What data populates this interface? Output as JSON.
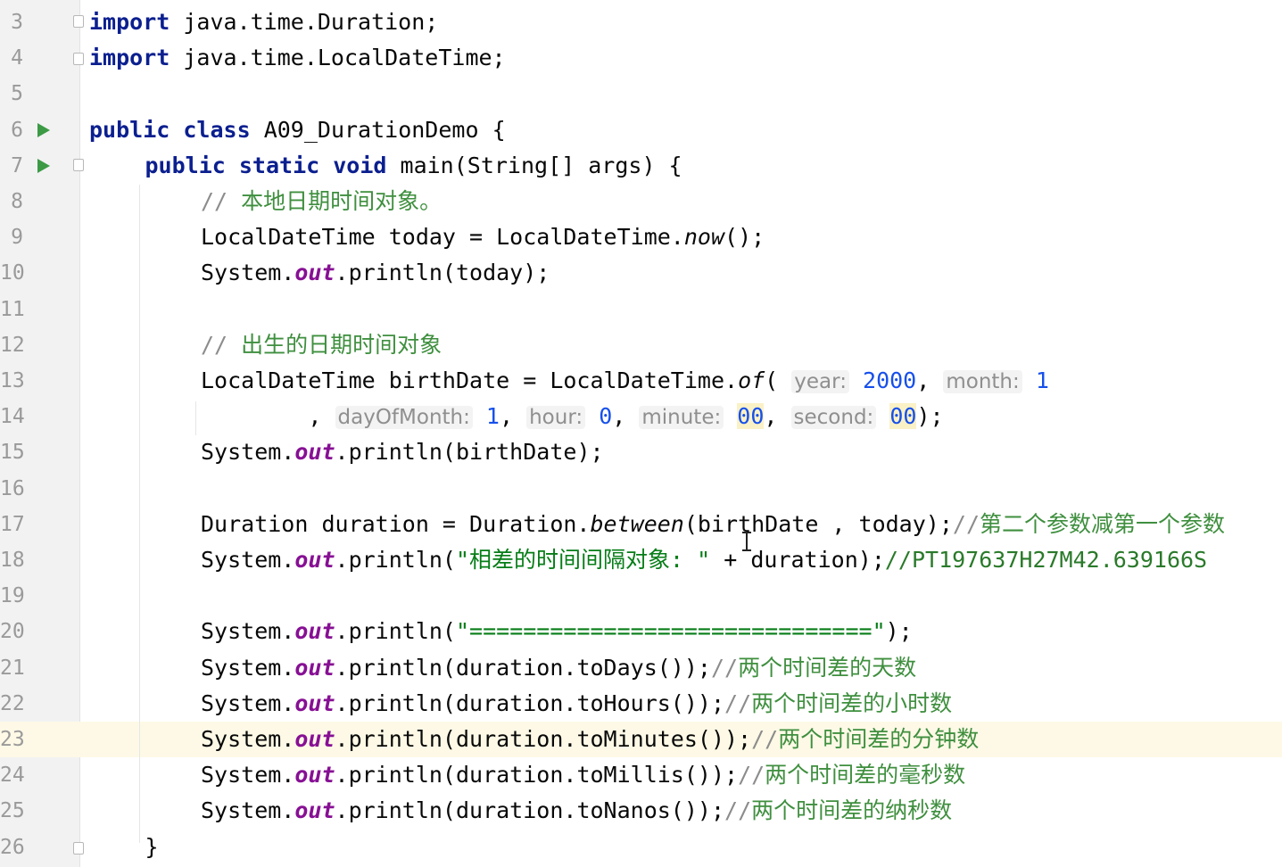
{
  "editor": {
    "lines": [
      {
        "n": "3",
        "indent": 0,
        "fold": "start",
        "parts": [
          {
            "t": "import",
            "c": "kw"
          },
          {
            "t": " java.time.Duration;"
          }
        ]
      },
      {
        "n": "4",
        "indent": 0,
        "fold": "end",
        "parts": [
          {
            "t": "import",
            "c": "kw"
          },
          {
            "t": " java.time.LocalDateTime;"
          }
        ]
      },
      {
        "n": "5",
        "indent": 0,
        "parts": []
      },
      {
        "n": "6",
        "indent": 0,
        "run": true,
        "parts": [
          {
            "t": "public",
            "c": "kw"
          },
          {
            "t": " "
          },
          {
            "t": "class",
            "c": "kw"
          },
          {
            "t": " A09_DurationDemo {"
          }
        ]
      },
      {
        "n": "7",
        "indent": 1,
        "run": true,
        "fold": "start",
        "parts": [
          {
            "t": "public",
            "c": "kw"
          },
          {
            "t": " "
          },
          {
            "t": "static",
            "c": "kw"
          },
          {
            "t": " "
          },
          {
            "t": "void",
            "c": "kw"
          },
          {
            "t": " main(String[] args) {"
          }
        ]
      },
      {
        "n": "8",
        "indent": 2,
        "parts": [
          {
            "t": "// ",
            "c": "cm"
          },
          {
            "t": "本地日期时间对象。",
            "c": "cm-cn"
          }
        ]
      },
      {
        "n": "9",
        "indent": 2,
        "parts": [
          {
            "t": "LocalDateTime today = LocalDateTime."
          },
          {
            "t": "now",
            "c": "it"
          },
          {
            "t": "();"
          }
        ]
      },
      {
        "n": "10",
        "indent": 2,
        "parts": [
          {
            "t": "System."
          },
          {
            "t": "out",
            "c": "it-purple"
          },
          {
            "t": ".println(today);"
          }
        ]
      },
      {
        "n": "11",
        "indent": 2,
        "parts": []
      },
      {
        "n": "12",
        "indent": 2,
        "parts": [
          {
            "t": "// ",
            "c": "cm"
          },
          {
            "t": "出生的日期时间对象",
            "c": "cm-cn"
          }
        ]
      },
      {
        "n": "13",
        "indent": 2,
        "parts": [
          {
            "t": "LocalDateTime birthDate = LocalDateTime."
          },
          {
            "t": "of",
            "c": "it"
          },
          {
            "t": "( "
          },
          {
            "t": "year:",
            "c": "hint"
          },
          {
            "t": " "
          },
          {
            "t": "2000",
            "c": "num"
          },
          {
            "t": ", "
          },
          {
            "t": "month:",
            "c": "hint"
          },
          {
            "t": " "
          },
          {
            "t": "1",
            "c": "num"
          }
        ]
      },
      {
        "n": "14",
        "indent": 2,
        "parts": [
          {
            "t": "        , "
          },
          {
            "t": "dayOfMonth:",
            "c": "hint"
          },
          {
            "t": " "
          },
          {
            "t": "1",
            "c": "num"
          },
          {
            "t": ", "
          },
          {
            "t": "hour:",
            "c": "hint"
          },
          {
            "t": " "
          },
          {
            "t": "0",
            "c": "num"
          },
          {
            "t": ", "
          },
          {
            "t": "minute:",
            "c": "hint"
          },
          {
            "t": " "
          },
          {
            "t": "00",
            "c": "num hl-num"
          },
          {
            "t": ", "
          },
          {
            "t": "second:",
            "c": "hint"
          },
          {
            "t": " "
          },
          {
            "t": "00",
            "c": "num hl-num"
          },
          {
            "t": ");"
          }
        ]
      },
      {
        "n": "15",
        "indent": 2,
        "parts": [
          {
            "t": "System."
          },
          {
            "t": "out",
            "c": "it-purple"
          },
          {
            "t": ".println(birthDate);"
          }
        ]
      },
      {
        "n": "16",
        "indent": 2,
        "parts": []
      },
      {
        "n": "17",
        "indent": 2,
        "parts": [
          {
            "t": "Duration duration = Duration."
          },
          {
            "t": "between",
            "c": "it"
          },
          {
            "t": "(birthDate , today);"
          },
          {
            "t": "//",
            "c": "cm"
          },
          {
            "t": "第二个参数减第一个参数",
            "c": "cm-cn"
          }
        ]
      },
      {
        "n": "18",
        "indent": 2,
        "parts": [
          {
            "t": "System."
          },
          {
            "t": "out",
            "c": "it-purple"
          },
          {
            "t": ".println("
          },
          {
            "t": "\"相差的时间间隔对象: \"",
            "c": "str"
          },
          {
            "t": " + duration);"
          },
          {
            "t": "//PT197637H27M42.639166S",
            "c": "cm-green"
          }
        ]
      },
      {
        "n": "19",
        "indent": 2,
        "parts": []
      },
      {
        "n": "20",
        "indent": 2,
        "parts": [
          {
            "t": "System."
          },
          {
            "t": "out",
            "c": "it-purple"
          },
          {
            "t": ".println("
          },
          {
            "t": "\"==============================\"",
            "c": "str"
          },
          {
            "t": ");"
          }
        ]
      },
      {
        "n": "21",
        "indent": 2,
        "parts": [
          {
            "t": "System."
          },
          {
            "t": "out",
            "c": "it-purple"
          },
          {
            "t": ".println(duration.toDays());"
          },
          {
            "t": "//",
            "c": "cm"
          },
          {
            "t": "两个时间差的天数",
            "c": "cm-cn"
          }
        ]
      },
      {
        "n": "22",
        "indent": 2,
        "parts": [
          {
            "t": "System."
          },
          {
            "t": "out",
            "c": "it-purple"
          },
          {
            "t": ".println(duration.toHours());"
          },
          {
            "t": "//",
            "c": "cm"
          },
          {
            "t": "两个时间差的小时数",
            "c": "cm-cn"
          }
        ]
      },
      {
        "n": "23",
        "indent": 2,
        "current": true,
        "parts": [
          {
            "t": "System."
          },
          {
            "t": "out",
            "c": "it-purple"
          },
          {
            "t": ".println(duration.toMinutes());"
          },
          {
            "t": "//",
            "c": "cm"
          },
          {
            "t": "两个时间差的分钟数",
            "c": "cm-cn"
          }
        ]
      },
      {
        "n": "24",
        "indent": 2,
        "parts": [
          {
            "t": "System."
          },
          {
            "t": "out",
            "c": "it-purple"
          },
          {
            "t": ".println(duration.toMillis());"
          },
          {
            "t": "//",
            "c": "cm"
          },
          {
            "t": "两个时间差的毫秒数",
            "c": "cm-cn"
          }
        ]
      },
      {
        "n": "25",
        "indent": 2,
        "parts": [
          {
            "t": "System."
          },
          {
            "t": "out",
            "c": "it-purple"
          },
          {
            "t": ".println(duration.toNanos());"
          },
          {
            "t": "//",
            "c": "cm"
          },
          {
            "t": "两个时间差的纳秒数",
            "c": "cm-cn"
          }
        ]
      },
      {
        "n": "26",
        "indent": 1,
        "fold": "end",
        "parts": [
          {
            "t": "}"
          }
        ]
      }
    ]
  }
}
